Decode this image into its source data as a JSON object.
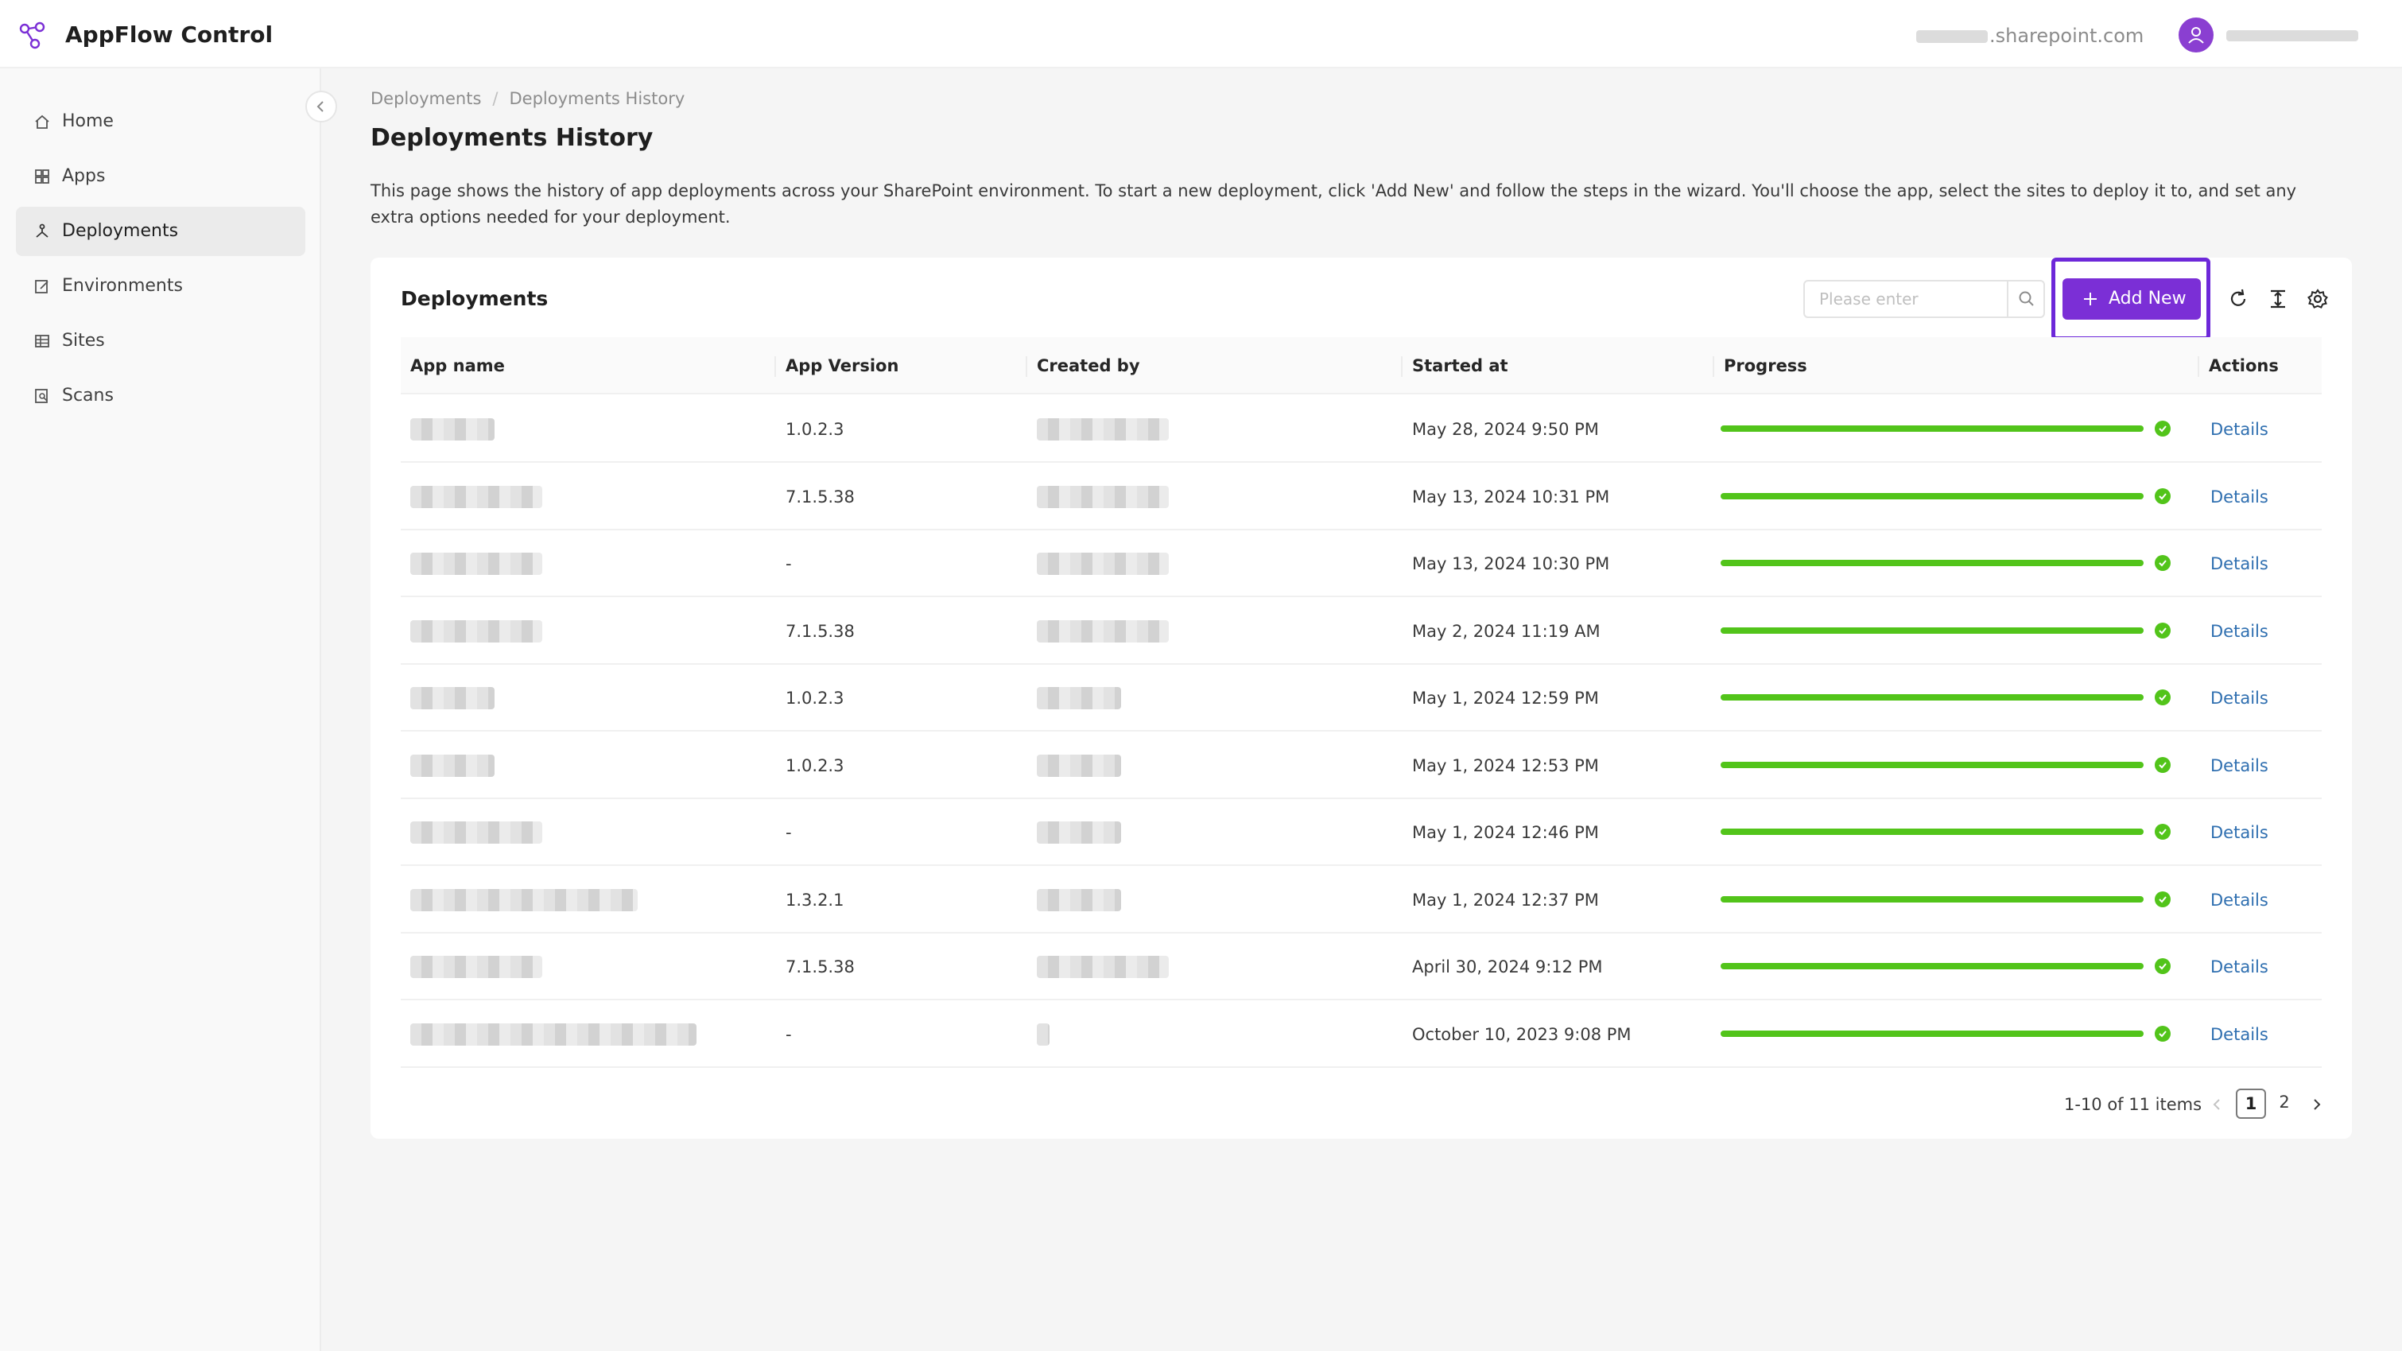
{
  "app": {
    "title": "AppFlow Control",
    "tenant_suffix": ".sharepoint.com",
    "accent_color": "#7b2fd6"
  },
  "sidebar": {
    "items": [
      {
        "label": "Home",
        "icon": "home-icon"
      },
      {
        "label": "Apps",
        "icon": "grid-icon"
      },
      {
        "label": "Deployments",
        "icon": "deploy-icon",
        "active": true
      },
      {
        "label": "Environments",
        "icon": "edit-icon"
      },
      {
        "label": "Sites",
        "icon": "table-icon"
      },
      {
        "label": "Scans",
        "icon": "scan-icon"
      }
    ]
  },
  "breadcrumb": {
    "parent": "Deployments",
    "separator": "/",
    "current": "Deployments History"
  },
  "page": {
    "title": "Deployments History",
    "description": "This page shows the history of app deployments across your SharePoint environment. To start a new deployment, click 'Add New' and follow the steps in the wizard. You'll choose the app, select the sites to deploy it to, and set any extra options needed for your deployment."
  },
  "card": {
    "title": "Deployments",
    "search_placeholder": "Please enter",
    "add_label": "Add New"
  },
  "table": {
    "columns": [
      "App name",
      "App Version",
      "Created by",
      "Started at",
      "Progress",
      "Actions"
    ],
    "rows": [
      {
        "version": "1.0.2.3",
        "started": "May 28, 2024 9:50 PM",
        "progress": 100,
        "action": "Details"
      },
      {
        "version": "7.1.5.38",
        "started": "May 13, 2024 10:31 PM",
        "progress": 100,
        "action": "Details"
      },
      {
        "version": "-",
        "started": "May 13, 2024 10:30 PM",
        "progress": 100,
        "action": "Details"
      },
      {
        "version": "7.1.5.38",
        "started": "May 2, 2024 11:19 AM",
        "progress": 100,
        "action": "Details"
      },
      {
        "version": "1.0.2.3",
        "started": "May 1, 2024 12:59 PM",
        "progress": 100,
        "action": "Details"
      },
      {
        "version": "1.0.2.3",
        "started": "May 1, 2024 12:53 PM",
        "progress": 100,
        "action": "Details"
      },
      {
        "version": "-",
        "started": "May 1, 2024 12:46 PM",
        "progress": 100,
        "action": "Details"
      },
      {
        "version": "1.3.2.1",
        "started": "May 1, 2024 12:37 PM",
        "progress": 100,
        "action": "Details"
      },
      {
        "version": "7.1.5.38",
        "started": "April 30, 2024 9:12 PM",
        "progress": 100,
        "action": "Details"
      },
      {
        "version": "-",
        "started": "October 10, 2023 9:08 PM",
        "progress": 100,
        "action": "Details"
      }
    ]
  },
  "pagination": {
    "total": "1-10 of 11 items",
    "pages": [
      "1",
      "2"
    ],
    "current": "1"
  },
  "colors": {
    "progress": "#52c41a",
    "link": "#2f6fb0"
  }
}
